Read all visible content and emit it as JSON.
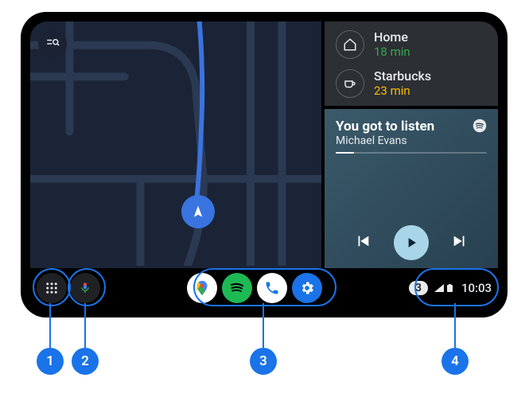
{
  "destinations": [
    {
      "label": "Home",
      "eta": "18 min",
      "icon": "home-icon",
      "eta_class": "dest-eta-green"
    },
    {
      "label": "Starbucks",
      "eta": "23 min",
      "icon": "coffee-icon",
      "eta_class": "dest-eta-amber"
    }
  ],
  "media": {
    "title": "You got to listen",
    "artist": "Michael Evans",
    "progress_percent": 12,
    "provider_icon": "spotify-icon"
  },
  "dock_apps": [
    {
      "name": "google-maps-app"
    },
    {
      "name": "spotify-app"
    },
    {
      "name": "phone-app"
    },
    {
      "name": "settings-app"
    }
  ],
  "status": {
    "notification_count": "3",
    "time": "10:03"
  },
  "callouts": {
    "1": "1",
    "2": "2",
    "3": "3",
    "4": "4"
  }
}
